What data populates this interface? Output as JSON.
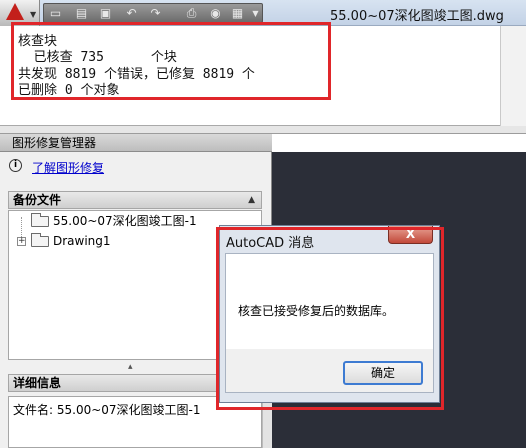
{
  "window": {
    "document_title": "55.00~07深化图竣工图.dwg"
  },
  "quick_access": {
    "icons": [
      "new-icon",
      "open-icon",
      "save-icon",
      "undo-icon",
      "redo-icon",
      "plot-icon",
      "publish-icon",
      "workspace-icon"
    ]
  },
  "command_history": {
    "lines": [
      "核查块",
      "  已核查 735      个块",
      "共发现 8819 个错误，已修复 8819 个",
      "已删除 0 个对象"
    ]
  },
  "recovery_manager": {
    "title": "图形修复管理器",
    "learn_link": "了解图形修复",
    "backup_section": {
      "heading": "备份文件",
      "items": [
        "55.00~07深化图竣工图-1",
        "Drawing1"
      ]
    },
    "details_section": {
      "heading": "详细信息",
      "filename_line": "文件名: 55.00~07深化图竣工图-1"
    }
  },
  "dialog": {
    "title": "AutoCAD 消息",
    "close_label": "X",
    "message": "核查已接受修复后的数据库。",
    "ok_label": "确定"
  },
  "colors": {
    "highlight_frame": "#e0262a",
    "drawing_area": "#2b2e38",
    "link": "#0000cc"
  }
}
